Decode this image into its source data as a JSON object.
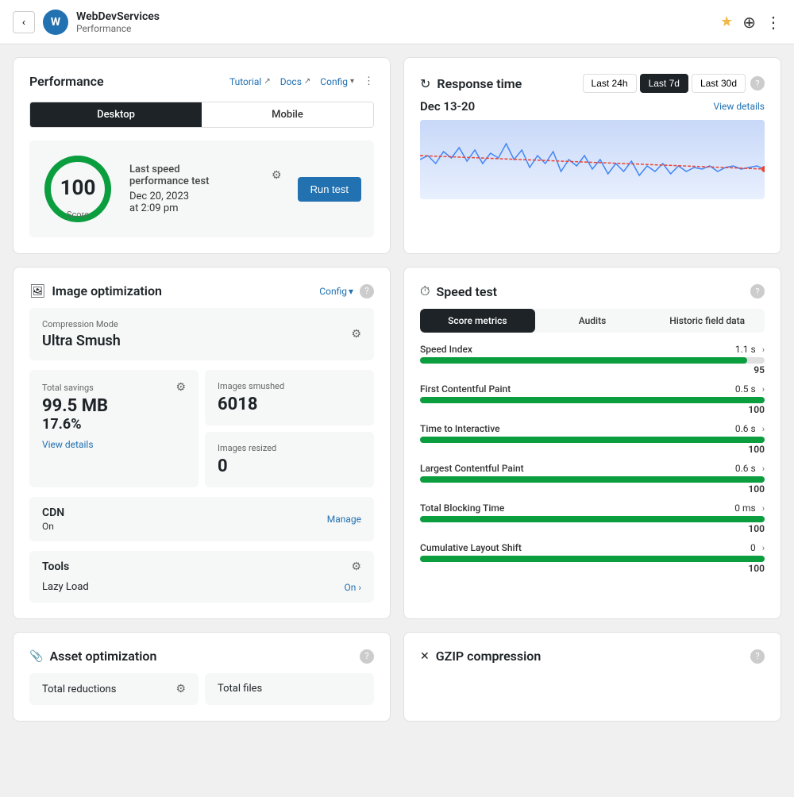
{
  "header": {
    "back_label": "‹",
    "site_avatar": "W",
    "site_name": "WebDevServices",
    "site_sub": "Performance",
    "star": "★",
    "wp": "⊕",
    "dots": "⋮"
  },
  "performance": {
    "title": "Performance",
    "tutorial": "Tutorial",
    "docs": "Docs",
    "config": "Config",
    "dots": "⋮",
    "tab_desktop": "Desktop",
    "tab_mobile": "Mobile",
    "score": "100",
    "score_label": "Score",
    "last_speed_label": "Last speed",
    "last_speed_sub": "performance test",
    "date": "Dec 20, 2023",
    "time": "at 2:09 pm",
    "run_test": "Run test"
  },
  "response_time": {
    "title": "Response time",
    "icon": "↻",
    "filter_24h": "Last 24h",
    "filter_7d": "Last 7d",
    "filter_30d": "Last 30d",
    "active_filter": "Last 7d",
    "date_range": "Dec 13-20",
    "view_details": "View details"
  },
  "image_optimization": {
    "title": "Image optimization",
    "icon": "🖼",
    "config": "Config",
    "compression_label": "Compression Mode",
    "compression_value": "Ultra Smush",
    "total_savings_label": "Total savings",
    "total_savings_value": "99.5 MB",
    "total_savings_pct": "17.6%",
    "view_details": "View details",
    "images_smushed_label": "Images smushed",
    "images_smushed_value": "6018",
    "images_resized_label": "Images resized",
    "images_resized_value": "0",
    "cdn_label": "CDN",
    "cdn_status": "On",
    "manage": "Manage",
    "tools_label": "Tools",
    "lazy_load_label": "Lazy Load",
    "lazy_load_status": "On ›"
  },
  "speed_test": {
    "title": "Speed test",
    "icon": "⏱",
    "tab_score": "Score metrics",
    "tab_audits": "Audits",
    "tab_historic": "Historic field data",
    "metrics": [
      {
        "name": "Speed Index",
        "score": 95,
        "bar_pct": 95,
        "time": "1.1 s",
        "has_arrow": true
      },
      {
        "name": "First Contentful Paint",
        "score": 100,
        "bar_pct": 100,
        "time": "0.5 s",
        "has_arrow": true
      },
      {
        "name": "Time to Interactive",
        "score": 100,
        "bar_pct": 100,
        "time": "0.6 s",
        "has_arrow": true
      },
      {
        "name": "Largest Contentful Paint",
        "score": 100,
        "bar_pct": 100,
        "time": "0.6 s",
        "has_arrow": true
      },
      {
        "name": "Total Blocking Time",
        "score": 100,
        "bar_pct": 100,
        "time": "0 ms",
        "has_arrow": true
      },
      {
        "name": "Cumulative Layout Shift",
        "score": 100,
        "bar_pct": 100,
        "time": "0",
        "has_arrow": true
      }
    ]
  },
  "asset_optimization": {
    "title": "Asset optimization",
    "icon": "📎",
    "total_reductions_label": "Total reductions",
    "total_files_label": "Total files"
  },
  "gzip": {
    "title": "GZIP compression",
    "icon": "✕"
  }
}
